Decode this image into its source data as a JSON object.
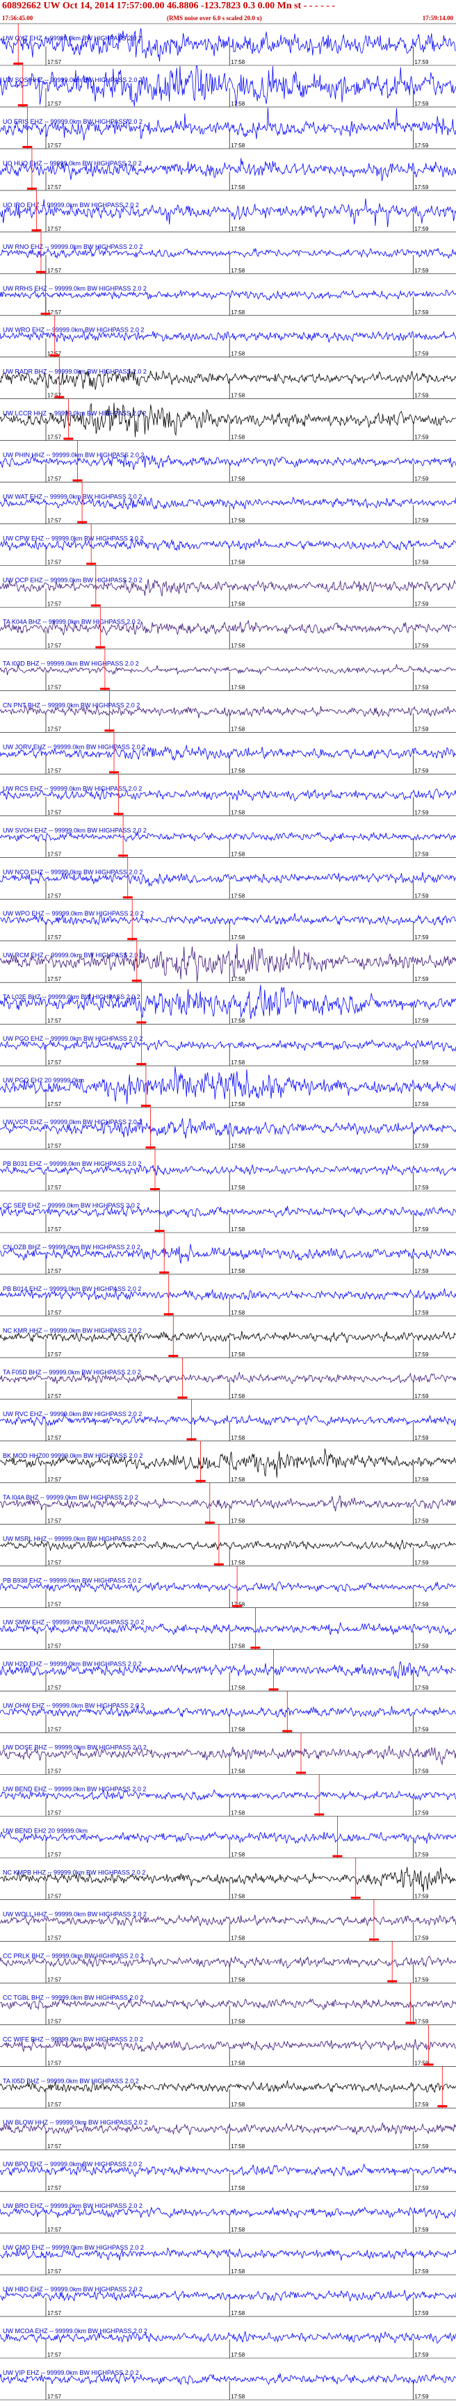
{
  "header": {
    "title": "60892662 UW Oct 14, 2014 17:57:00.00    46.8806  -123.7823   0.3  0.00  Mn st - - - - - -",
    "start_time": "17:56:45.00",
    "end_time": "17:59:14.00",
    "note": "(RMS noise over 6.0 s scaled 20.0 x)"
  },
  "colors": {
    "blue": "#0000ff",
    "black": "#000000",
    "purple": "#3c1478",
    "pick": "#ff0000",
    "label": "#0000cc"
  },
  "chart_data": {
    "type": "line",
    "x_unit": "time (UTC)",
    "xlim": [
      "17:56:45.00",
      "17:59:14.00"
    ],
    "tick_labels": [
      "17:57",
      "17:58",
      "17:59"
    ],
    "tick_times": [
      "17:57:00",
      "17:58:00",
      "17:59:00"
    ],
    "traces": [
      {
        "label": "UW OYZ EHZ -- 99999.0km BW  HIGHPASS  2.0  2",
        "color": "blue",
        "amp": 0.85,
        "burst": 0.3,
        "bw": 0.1,
        "bamp": 1.6,
        "pick": 0.04
      },
      {
        "label": "UW SQS HHZ -- 99999.0km BW  HIGHPASS  2.0  2",
        "color": "blue",
        "amp": 0.9,
        "burst": 0.38,
        "bw": 0.25,
        "bamp": 1.8,
        "spiky": true,
        "pick": 0.05
      },
      {
        "label": "UO ERIS EHZ -- 99999.0km BW  HIGHPASS  2.0  2",
        "color": "blue",
        "amp": 0.6,
        "spiky": true,
        "pick": 0.06
      },
      {
        "label": "UO HUO EHZ -- 99999.0km BW  HIGHPASS  2.0  2",
        "color": "blue",
        "amp": 0.6,
        "spiky": true,
        "pick": 0.07
      },
      {
        "label": "UO IRO EHZ -- 99999.0km BW  HIGHPASS  2.0  2",
        "color": "blue",
        "amp": 0.55,
        "spiky": true,
        "pick": 0.08
      },
      {
        "label": "UW RNO EHZ -- 99999.0km BW  HIGHPASS  2.0  2",
        "color": "blue",
        "amp": 0.35,
        "burst": 0.08,
        "bw": 0.06,
        "bamp": 1.3,
        "pick": 0.09
      },
      {
        "label": "UW RRHS EHZ -- 99999.0km BW  HIGHPASS  2.0  2",
        "color": "blue",
        "amp": 0.35,
        "pick": 0.1
      },
      {
        "label": "UW WRO EHZ -- 99999.0km BW  HIGHPASS  2.0  2",
        "color": "blue",
        "amp": 0.4,
        "pick": 0.12
      },
      {
        "label": "UW RADR BHZ -- 99999.0km BW  HIGHPASS  2.0  2",
        "color": "black",
        "amp": 0.45,
        "burst": 0.17,
        "bw": 0.22,
        "bamp": 1.9,
        "pick": 0.13
      },
      {
        "label": "UW LCCR HHZ -- 99999.0km BW  HIGHPASS  2.0  2",
        "color": "black",
        "amp": 0.55,
        "burst": 0.3,
        "bw": 0.17,
        "bamp": 3.0,
        "pick": 0.15
      },
      {
        "label": "UW PHIN HHZ -- 99999.0km BW  HIGHPASS  2.0  2",
        "color": "blue",
        "amp": 0.4,
        "burst": 0.3,
        "bw": 0.1,
        "bamp": 1.8,
        "pick": 0.17
      },
      {
        "label": "UW WAT EHZ -- 99999.0km BW  HIGHPASS  2.0  2",
        "color": "blue",
        "amp": 0.4,
        "burst": 0.32,
        "bw": 0.08,
        "bamp": 1.4,
        "pick": 0.18
      },
      {
        "label": "UW CPW EHZ -- 99999.0km BW  HIGHPASS  2.0  2",
        "color": "blue",
        "amp": 0.4,
        "burst": 0.33,
        "bw": 0.1,
        "bamp": 1.5,
        "pick": 0.2
      },
      {
        "label": "UW OCP EHZ -- 99999.0km BW  HIGHPASS  2.0  2",
        "color": "purple",
        "amp": 0.45,
        "burst": 0.34,
        "bw": 0.12,
        "bamp": 1.6,
        "pick": 0.21
      },
      {
        "label": "TA K04A BHZ -- 99999.0km BW  HIGHPASS  2.0  2",
        "color": "purple",
        "amp": 0.45,
        "burst": 0.35,
        "bw": 0.1,
        "bamp": 1.4,
        "pick": 0.22
      },
      {
        "label": "TA I03D BHZ -- 99999.0km BW  HIGHPASS  2.0  2",
        "color": "purple",
        "amp": 0.25,
        "spiky": true,
        "pick": 0.23
      },
      {
        "label": "CN PNT BHZ -- 99999.0km BW  HIGHPASS  2.0  2",
        "color": "purple",
        "amp": 0.4,
        "pick": 0.24
      },
      {
        "label": "UW JORV EHZ -- 99999.0km BW  HIGHPASS  2.0  2",
        "color": "blue",
        "amp": 0.45,
        "burst": 0.37,
        "bw": 0.08,
        "bamp": 1.6,
        "pick": 0.25
      },
      {
        "label": "UW RCS EHZ -- 99999.0km BW  HIGHPASS  2.0  2",
        "color": "blue",
        "amp": 0.4,
        "pick": 0.26
      },
      {
        "label": "UW SVOH EHZ -- 99999.0km BW  HIGHPASS  2.0  2",
        "color": "blue",
        "amp": 0.35,
        "pick": 0.27
      },
      {
        "label": "UW NCO EHZ -- 99999.0km BW  HIGHPASS  2.0  2",
        "color": "blue",
        "amp": 0.4,
        "burst": 0.32,
        "bw": 0.06,
        "bamp": 1.3,
        "pick": 0.28
      },
      {
        "label": "UW WPO EHZ -- 99999.0km BW  HIGHPASS  2.0  2",
        "color": "blue",
        "amp": 0.4,
        "pick": 0.29
      },
      {
        "label": "UW RCM EHZ -- 99999.0km BW  HIGHPASS  2.0  2",
        "color": "purple",
        "amp": 0.55,
        "burst": 0.48,
        "bw": 0.3,
        "bamp": 2.6,
        "pick": 0.3
      },
      {
        "label": "TA L02E BHZ -- 99999.0km BW  HIGHPASS  2.0  2",
        "color": "blue",
        "amp": 0.55,
        "burst": 0.52,
        "bw": 0.32,
        "bamp": 2.4,
        "pick": 0.31
      },
      {
        "label": "UW PGO EHZ -- 99999.0km BW  HIGHPASS  2.0  2",
        "color": "blue",
        "amp": 0.4,
        "pick": 0.31
      },
      {
        "label": "UW PGO EH2 20 99999.0km",
        "color": "blue",
        "amp": 0.55,
        "burst": 0.45,
        "bw": 0.3,
        "bamp": 2.6,
        "pick": 0.32
      },
      {
        "label": "UW VCR EHZ -- 99999.0km BW  HIGHPASS  2.0  2",
        "color": "blue",
        "amp": 0.45,
        "burst": 0.4,
        "bw": 0.22,
        "bamp": 2.0,
        "pick": 0.33
      },
      {
        "label": "PB B031 EHZ -- 99999.0km BW  HIGHPASS  2.0  2",
        "color": "blue",
        "amp": 0.35,
        "burst": 0.36,
        "bw": 0.06,
        "bamp": 1.4,
        "pick": 0.34
      },
      {
        "label": "CC SEP EHZ -- 99999.0km BW  HIGHPASS  2.0  2",
        "color": "blue",
        "amp": 0.4,
        "pick": 0.35
      },
      {
        "label": "CN OZB BHZ -- 99999.0km BW  HIGHPASS  2.0  2",
        "color": "blue",
        "amp": 0.45,
        "burst": 0.37,
        "bw": 0.1,
        "bamp": 1.5,
        "pick": 0.36
      },
      {
        "label": "PB B014 EHZ -- 99999.0km BW  HIGHPASS  2.0  2",
        "color": "blue",
        "amp": 0.4,
        "pick": 0.37
      },
      {
        "label": "NC KMR HHZ -- 99999.0km BW  HIGHPASS  2.0  2",
        "color": "black",
        "amp": 0.4,
        "pick": 0.38
      },
      {
        "label": "TA F05D BHZ -- 99999.0km BW  HIGHPASS  2.0  2",
        "color": "purple",
        "amp": 0.35,
        "pick": 0.4
      },
      {
        "label": "UW RVC EHZ -- 99999.0km BW  HIGHPASS  2.0  2",
        "color": "blue",
        "amp": 0.4,
        "pick": 0.42
      },
      {
        "label": "BK MOD HHZ00 99999.0km BW  HIGHPASS  2.0  2",
        "color": "black",
        "amp": 0.45,
        "burst": 0.6,
        "bw": 0.25,
        "bamp": 2.2,
        "pick": 0.44
      },
      {
        "label": "TA I04A BHZ -- 99999.0km BW  HIGHPASS  2.0  2",
        "color": "purple",
        "amp": 0.4,
        "burst": 0.75,
        "bw": 0.05,
        "bamp": 1.8,
        "pick": 0.46
      },
      {
        "label": "UW MSRL HHZ -- 99999.0km BW  HIGHPASS  2.0  2",
        "color": "black",
        "amp": 0.35,
        "pick": 0.48
      },
      {
        "label": "PB B938 EHZ -- 99999.0km BW  HIGHPASS  2.0  2",
        "color": "blue",
        "amp": 0.35,
        "pick": 0.52
      },
      {
        "label": "UW SMW EHZ -- 99999.0km BW  HIGHPASS  2.0  2",
        "color": "blue",
        "amp": 0.4,
        "pick": 0.56
      },
      {
        "label": "UW H2O EHZ -- 99999.0km BW  HIGHPASS  2.0  2",
        "color": "blue",
        "amp": 0.45,
        "burst": 0.9,
        "bw": 0.06,
        "bamp": 1.8,
        "pick": 0.6
      },
      {
        "label": "UW OHW EHZ -- 99999.0km BW  HIGHPASS  2.0  2",
        "color": "blue",
        "amp": 0.4,
        "pick": 0.63
      },
      {
        "label": "UW DOSE BHZ -- 99999.0km BW  HIGHPASS  2.0  2",
        "color": "purple",
        "amp": 0.45,
        "burst": 0.95,
        "bw": 0.04,
        "bamp": 1.8,
        "pick": 0.66
      },
      {
        "label": "UW BEND EHZ -- 99999.0km BW  HIGHPASS  2.0  2",
        "color": "blue",
        "amp": 0.35,
        "pick": 0.7
      },
      {
        "label": "UW BEND EH2 20 99999.0km",
        "color": "blue",
        "amp": 0.4,
        "pick": 0.74
      },
      {
        "label": "NC KMPB HHZ -- 99999.0km BW  HIGHPASS  2.0  2",
        "color": "black",
        "amp": 0.45,
        "burst": 0.92,
        "bw": 0.1,
        "bamp": 2.4,
        "pick": 0.78
      },
      {
        "label": "UW WOLL HHZ -- 99999.0km BW  HIGHPASS  2.0  2",
        "color": "purple",
        "amp": 0.4,
        "pick": 0.82
      },
      {
        "label": "CC PRLK BHZ -- 99999.0km BW  HIGHPASS  2.0  2",
        "color": "purple",
        "amp": 0.4,
        "pick": 0.86
      },
      {
        "label": "CC TGBL BHZ -- 99999.0km BW  HIGHPASS  2.0  2",
        "color": "purple",
        "amp": 0.4,
        "pick": 0.9
      },
      {
        "label": "CC WIFE BHZ -- 99999.0km BW  HIGHPASS  2.0  2",
        "color": "purple",
        "amp": 0.4,
        "pick": 0.94
      },
      {
        "label": "TA I05D BHZ -- 99999.0km BW  HIGHPASS  2.0  2",
        "color": "black",
        "amp": 0.4,
        "pick": 0.97
      },
      {
        "label": "UW BLOW HHZ -- 99999.0km BW  HIGHPASS  2.0  2",
        "color": "purple",
        "amp": 0.4
      },
      {
        "label": "UW BPO EHZ -- 99999.0km BW  HIGHPASS  2.0  2",
        "color": "blue",
        "amp": 0.4
      },
      {
        "label": "UW BRO EHZ -- 99999.0km BW  HIGHPASS  2.0  2",
        "color": "blue",
        "amp": 0.4
      },
      {
        "label": "UW GMO EHZ -- 99999.0km BW  HIGHPASS  2.0  2",
        "color": "blue",
        "amp": 0.4
      },
      {
        "label": "UW HBO EHZ -- 99999.0km BW  HIGHPASS  2.0  2",
        "color": "blue",
        "amp": 0.4
      },
      {
        "label": "UW MCOA EHZ -- 99999.0km BW  HIGHPASS  2.0  2",
        "color": "blue",
        "amp": 0.4
      },
      {
        "label": "UW VIP EHZ -- 99999.0km BW  HIGHPASS  2.0  2",
        "color": "blue",
        "amp": 0.4
      }
    ]
  }
}
